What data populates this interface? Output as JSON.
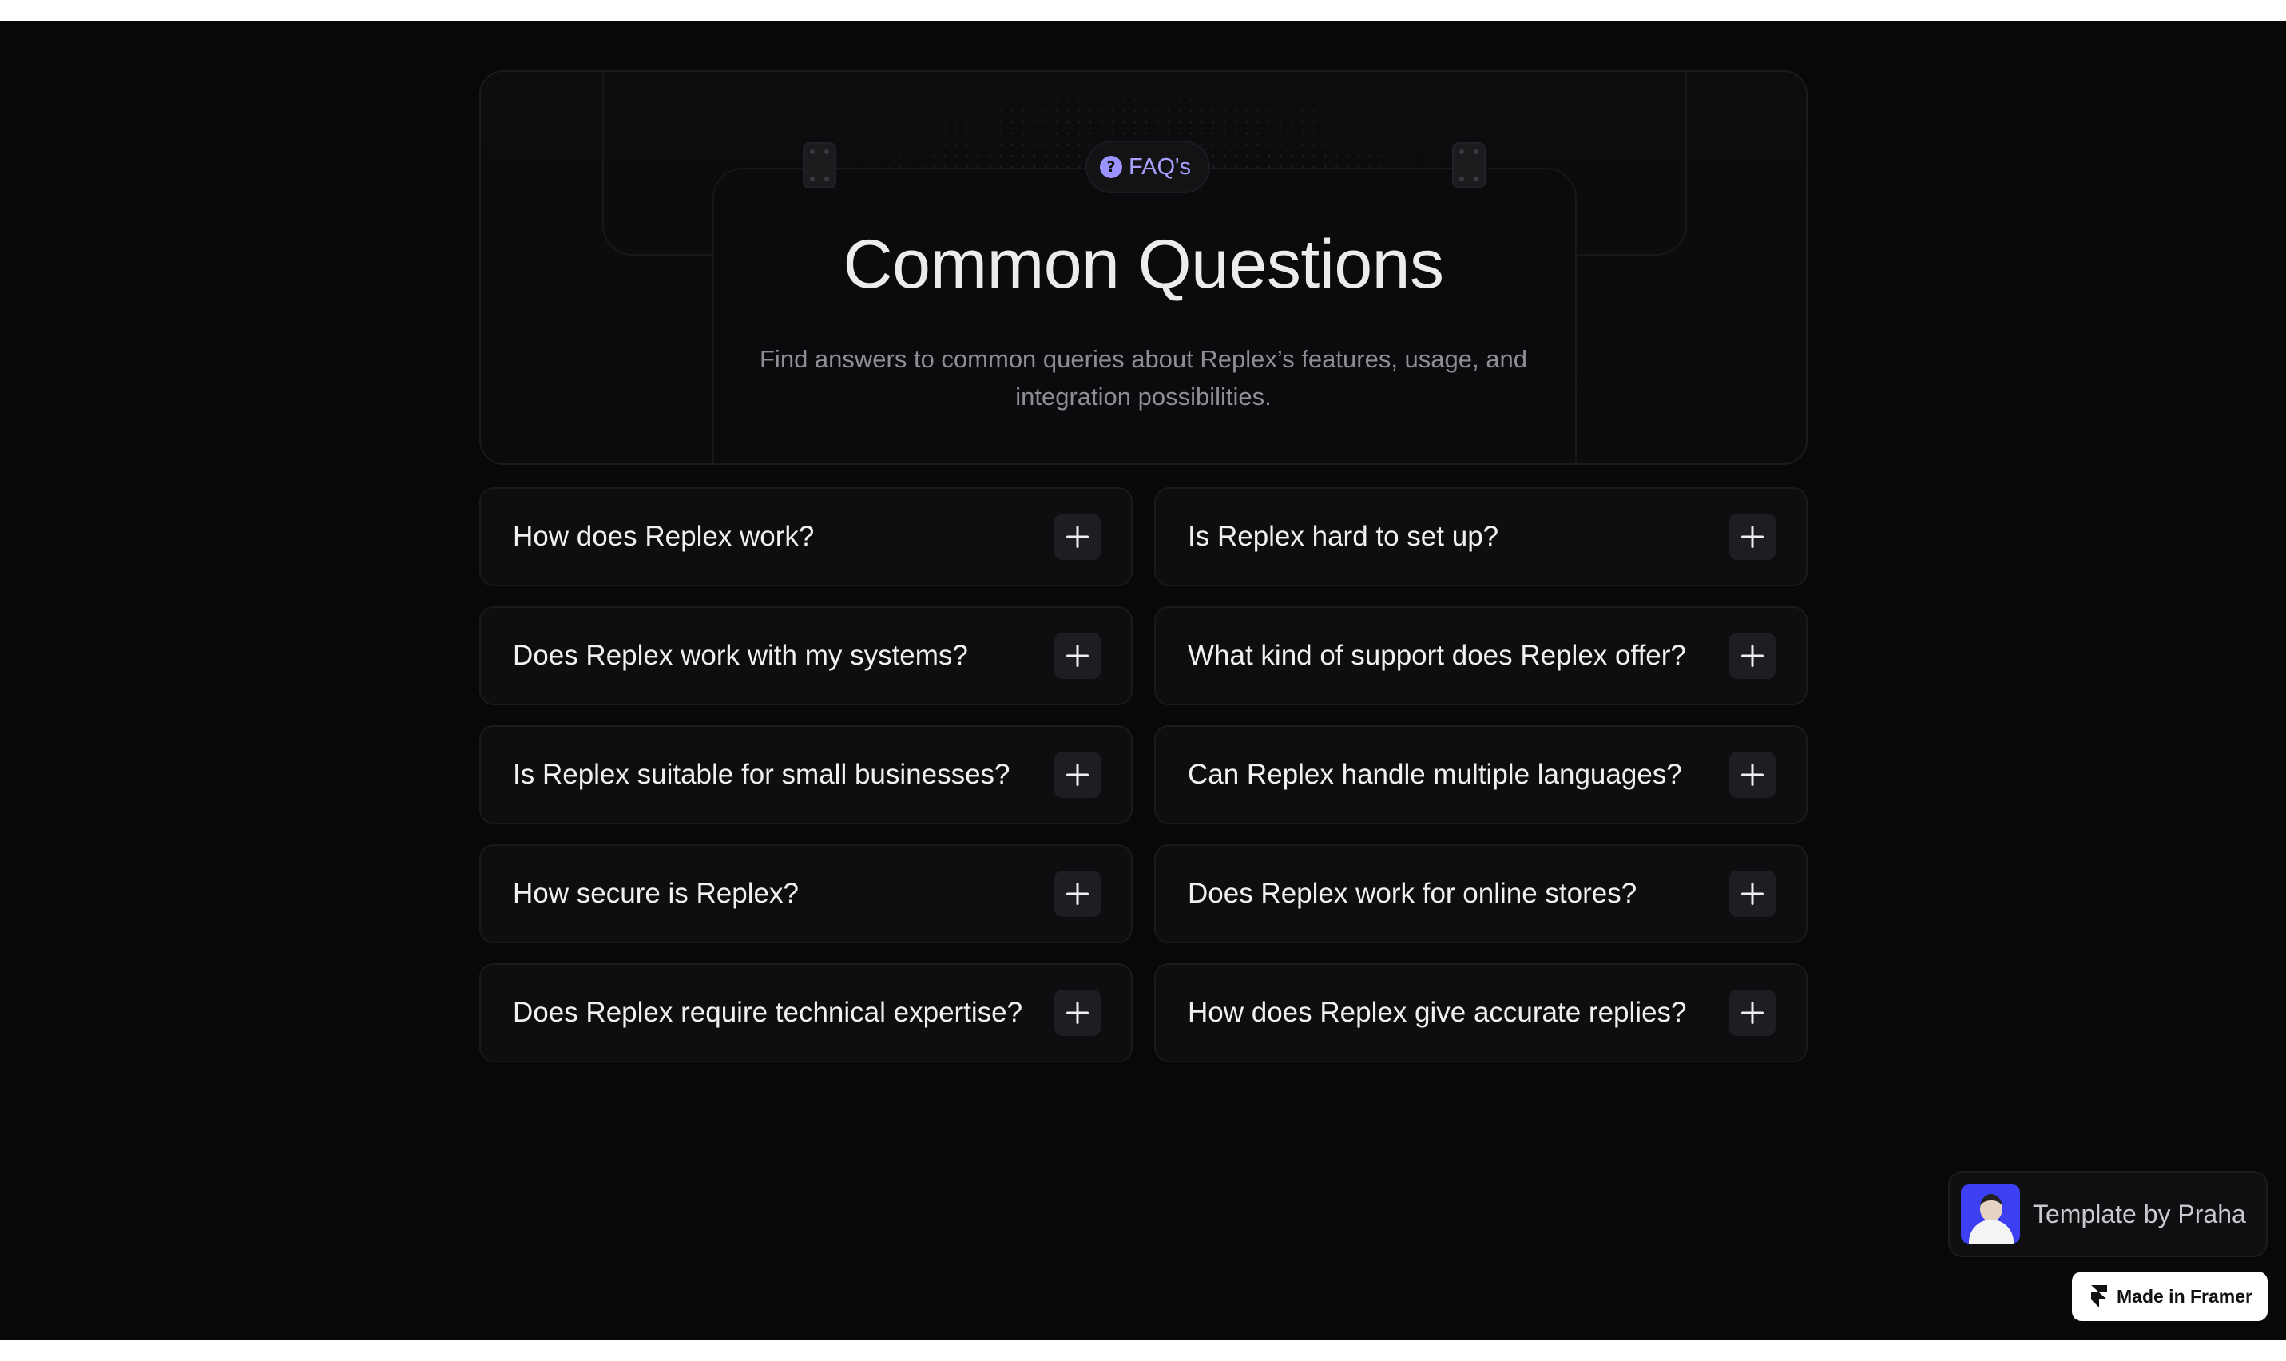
{
  "hero": {
    "badge_icon": "question-circle-icon",
    "badge_label": "FAQ's",
    "title": "Common Questions",
    "subtitle": "Find answers to common queries about Replex’s features, usage, and integration possibilities."
  },
  "faq": {
    "items": [
      {
        "question": "How does Replex work?"
      },
      {
        "question": "Is Replex hard to set up?"
      },
      {
        "question": "Does Replex work with my systems?"
      },
      {
        "question": "What kind of support does Replex offer?"
      },
      {
        "question": "Is Replex suitable for small businesses?"
      },
      {
        "question": "Can Replex handle multiple languages?"
      },
      {
        "question": "How secure is Replex?"
      },
      {
        "question": "Does Replex work for online stores?"
      },
      {
        "question": "Does Replex require technical expertise?"
      },
      {
        "question": "How does Replex give accurate replies?"
      }
    ],
    "expand_icon": "plus-icon"
  },
  "template_badge": {
    "label": "Template by Praha"
  },
  "framer_badge": {
    "label": "Made in Framer"
  },
  "colors": {
    "background": "#080809",
    "accent": "#a8a2ff",
    "text": "#f0f0f2",
    "muted": "#8e8e94"
  }
}
